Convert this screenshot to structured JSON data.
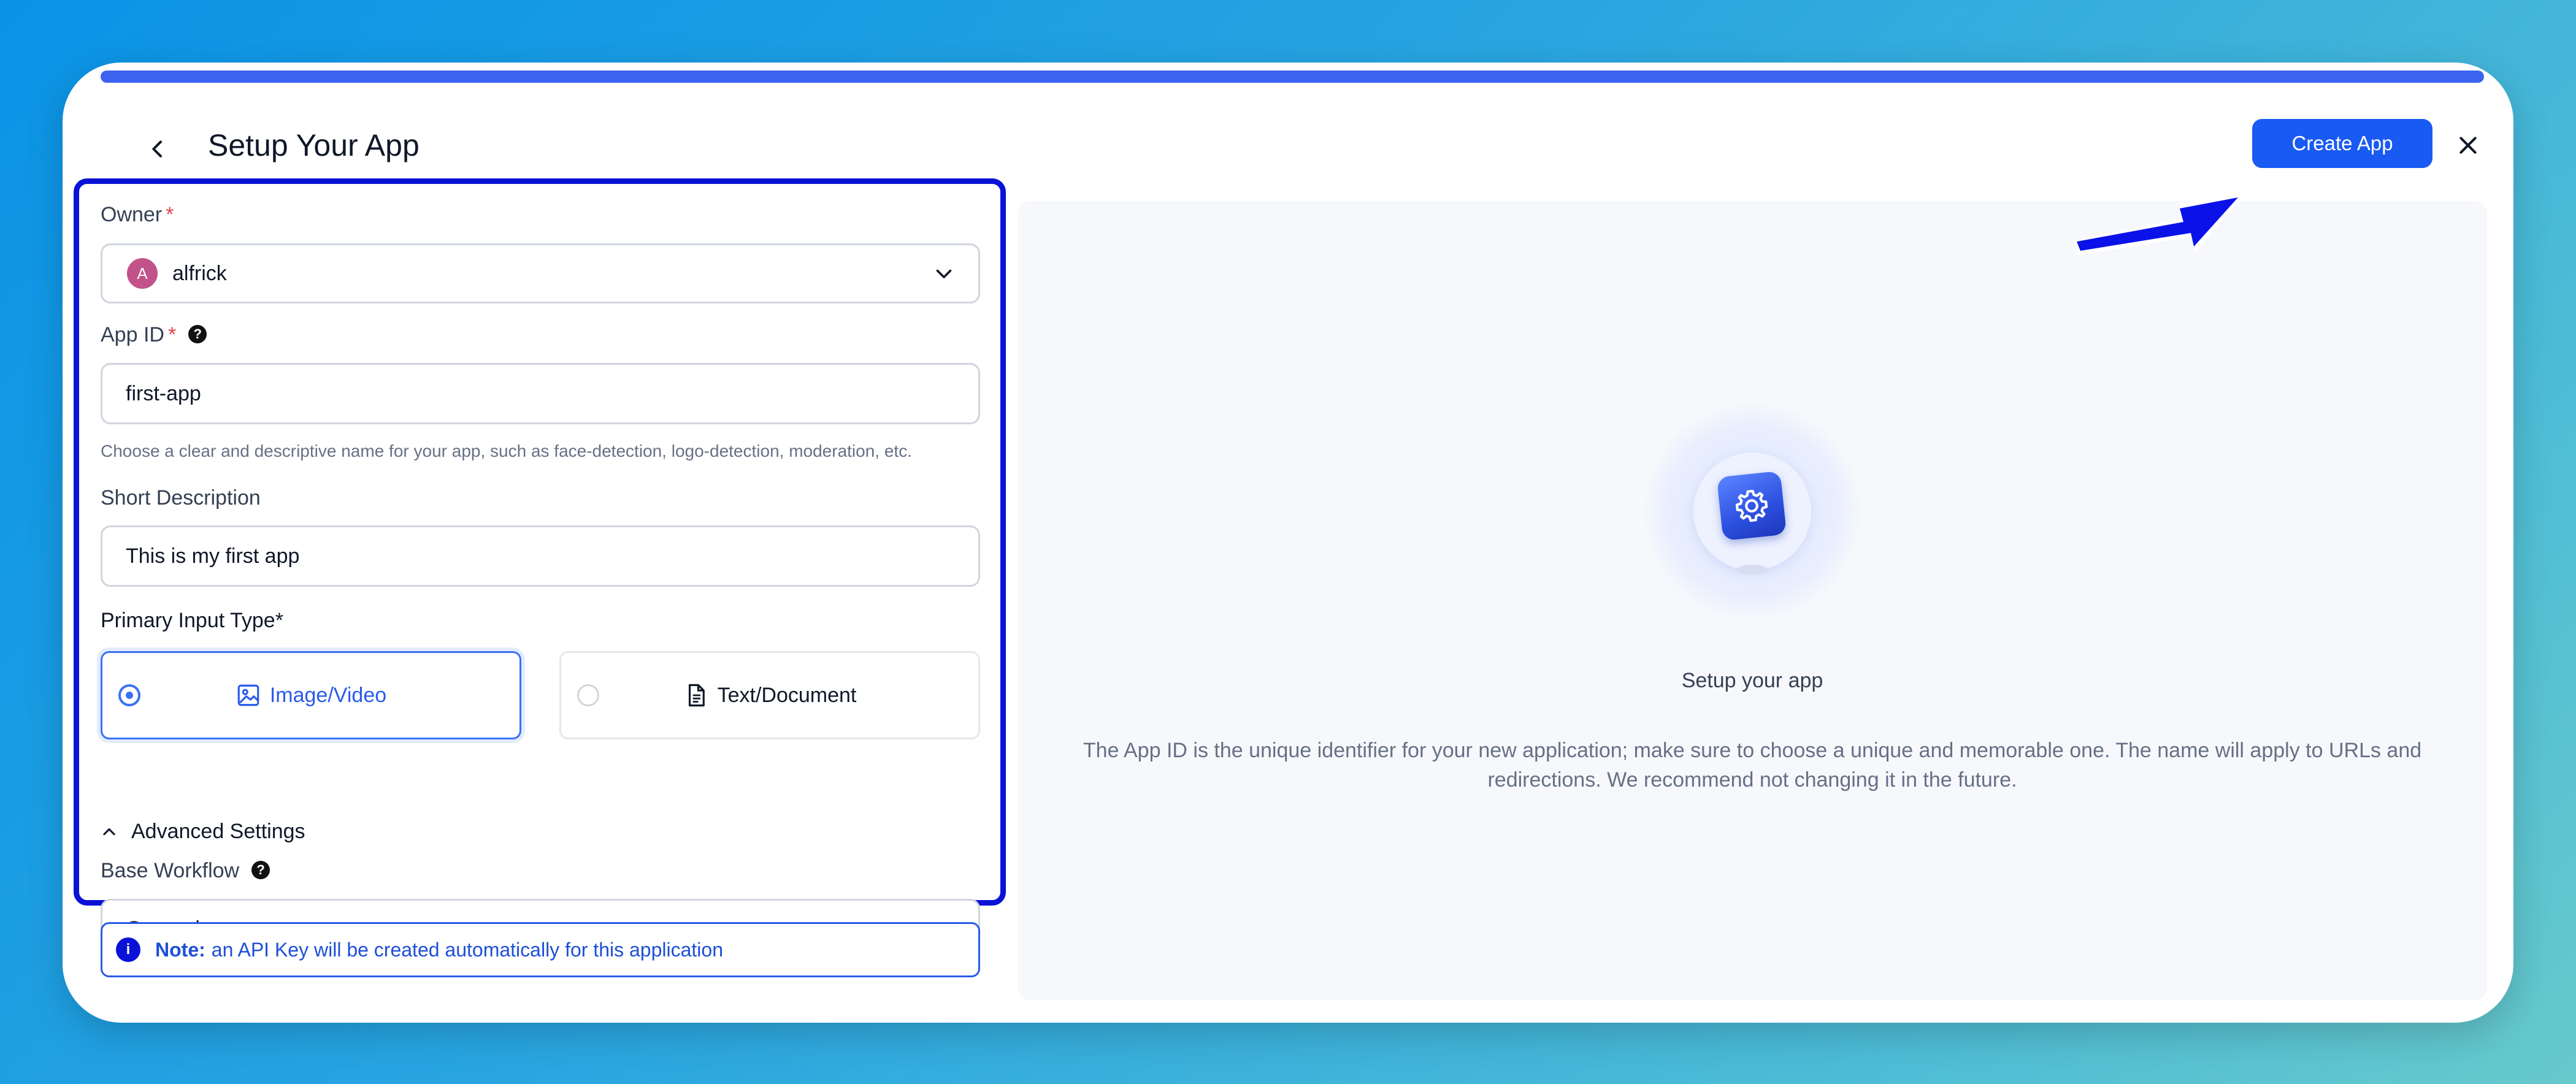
{
  "header": {
    "title": "Setup Your App",
    "create_label": "Create App",
    "progress_fraction": 1.0
  },
  "form": {
    "owner": {
      "label": "Owner",
      "required": "*",
      "avatar_letter": "A",
      "value": "alfrick"
    },
    "app_id": {
      "label": "App ID",
      "required": "*",
      "help": "?",
      "value": "first-app",
      "hint": "Choose a clear and descriptive name for your app, such as face-detection, logo-detection, moderation, etc."
    },
    "short_description": {
      "label": "Short Description",
      "value": "This is my first app"
    },
    "primary_input": {
      "label": "Primary Input Type*",
      "options": [
        {
          "label": "Image/Video",
          "selected": true,
          "icon": "image-icon"
        },
        {
          "label": "Text/Document",
          "selected": false,
          "icon": "document-icon"
        }
      ]
    },
    "advanced": {
      "label": "Advanced Settings",
      "expanded": true
    },
    "base_workflow": {
      "label": "Base Workflow",
      "help": "?",
      "value": "General"
    },
    "note": {
      "icon": "i",
      "bold": "Note:",
      "text": "an API Key will be created automatically for this application"
    }
  },
  "panel": {
    "title": "Setup your app",
    "description": "The App ID is the unique identifier for your new application; make sure to choose a unique and memorable one. The name will apply to URLs and redirections. We recommend not changing it in the future.",
    "icon": "gear-icon"
  },
  "colors": {
    "accent": "#195af3",
    "highlight_border": "#0a12d6",
    "callout_arrow": "#0a12e8"
  }
}
